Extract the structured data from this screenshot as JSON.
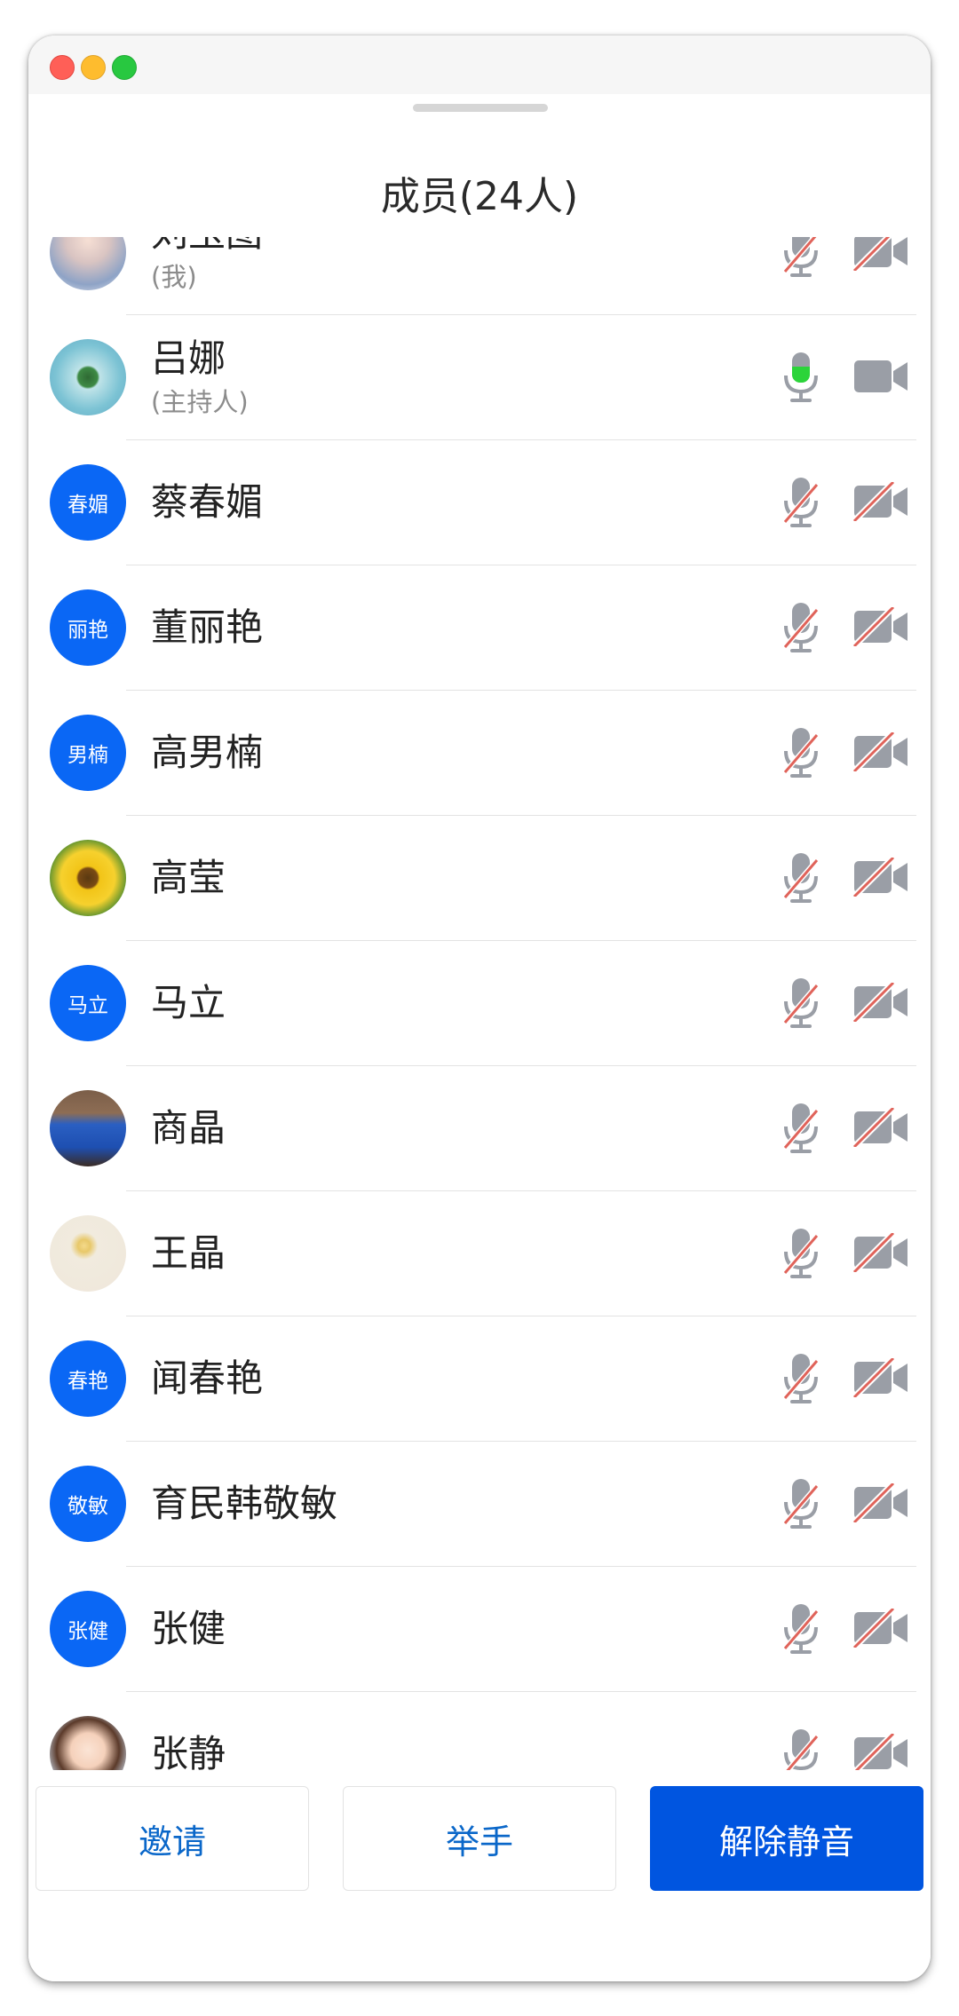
{
  "window": {
    "controls": [
      "close",
      "minimize",
      "zoom"
    ]
  },
  "header": {
    "title": "成员(24人)"
  },
  "colors": {
    "accent": "#0055e0",
    "avatar_blue": "#0a67f5",
    "mic_active": "#2bd43a",
    "muted_slash": "#e0635a",
    "icon_gray": "#9a9ea6"
  },
  "members": [
    {
      "name": "刘玉图",
      "role": "(我)",
      "avatar": {
        "type": "photo",
        "icon": "selfie-photo"
      },
      "mic": "muted",
      "camera": "off"
    },
    {
      "name": "吕娜",
      "role": "(主持人)",
      "avatar": {
        "type": "photo",
        "icon": "island-photo"
      },
      "mic": "active",
      "camera": "on"
    },
    {
      "name": "蔡春媚",
      "role": "",
      "avatar": {
        "type": "initials",
        "text": "春媚"
      },
      "mic": "muted",
      "camera": "off"
    },
    {
      "name": "董丽艳",
      "role": "",
      "avatar": {
        "type": "initials",
        "text": "丽艳"
      },
      "mic": "muted",
      "camera": "off"
    },
    {
      "name": "高男楠",
      "role": "",
      "avatar": {
        "type": "initials",
        "text": "男楠"
      },
      "mic": "muted",
      "camera": "off"
    },
    {
      "name": "高莹",
      "role": "",
      "avatar": {
        "type": "photo",
        "icon": "sunflower-photo"
      },
      "mic": "muted",
      "camera": "off"
    },
    {
      "name": "马立",
      "role": "",
      "avatar": {
        "type": "initials",
        "text": "马立"
      },
      "mic": "muted",
      "camera": "off"
    },
    {
      "name": "商晶",
      "role": "",
      "avatar": {
        "type": "photo",
        "icon": "person-photo"
      },
      "mic": "muted",
      "camera": "off"
    },
    {
      "name": "王晶",
      "role": "",
      "avatar": {
        "type": "photo",
        "icon": "drawing-photo"
      },
      "mic": "muted",
      "camera": "off"
    },
    {
      "name": "闻春艳",
      "role": "",
      "avatar": {
        "type": "initials",
        "text": "春艳"
      },
      "mic": "muted",
      "camera": "off"
    },
    {
      "name": "育民韩敬敏",
      "role": "",
      "avatar": {
        "type": "initials",
        "text": "敬敏"
      },
      "mic": "muted",
      "camera": "off"
    },
    {
      "name": "张健",
      "role": "",
      "avatar": {
        "type": "initials",
        "text": "张健"
      },
      "mic": "muted",
      "camera": "off"
    },
    {
      "name": "张静",
      "role": "",
      "avatar": {
        "type": "photo",
        "icon": "cartoon-photo"
      },
      "mic": "muted",
      "camera": "off"
    }
  ],
  "footer": {
    "invite_label": "邀请",
    "raise_hand_label": "举手",
    "unmute_label": "解除静音"
  }
}
